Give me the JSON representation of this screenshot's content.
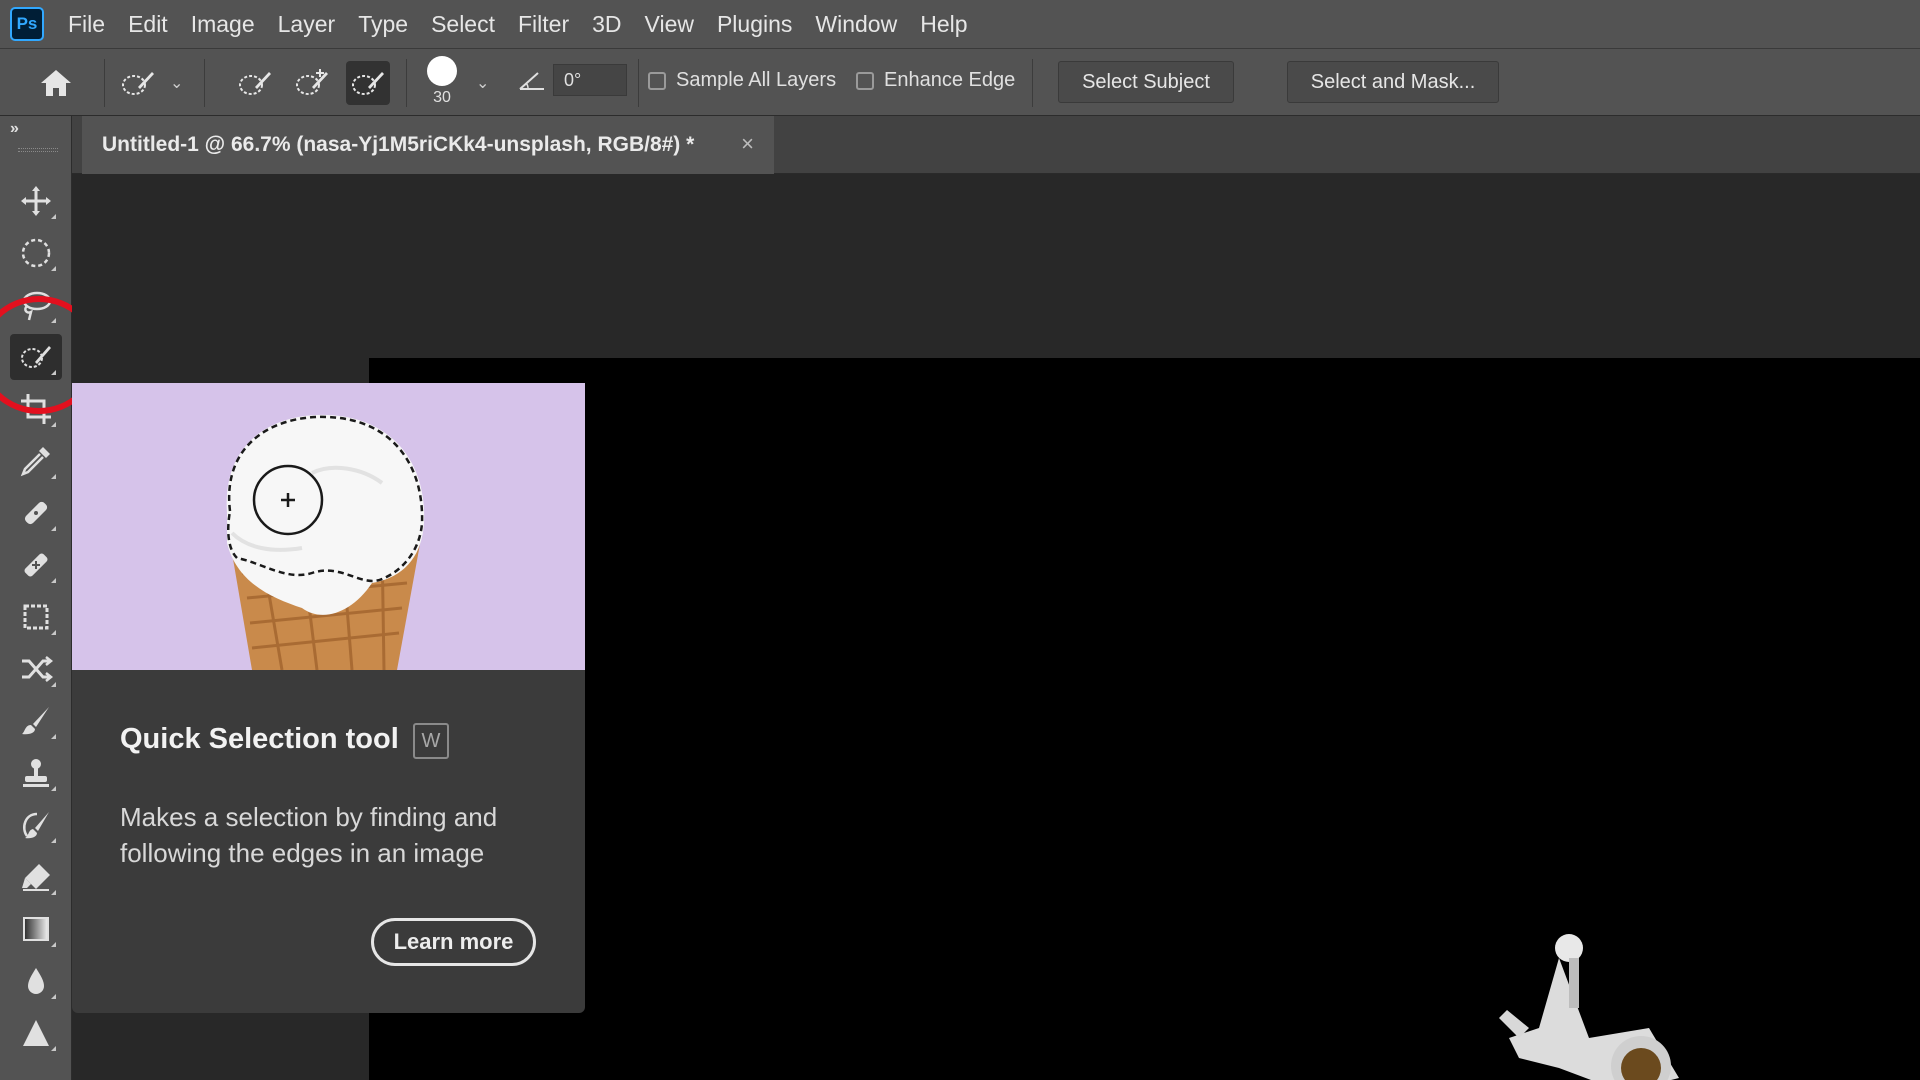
{
  "app": {
    "logo_text": "Ps"
  },
  "menu": [
    "File",
    "Edit",
    "Image",
    "Layer",
    "Type",
    "Select",
    "Filter",
    "3D",
    "View",
    "Plugins",
    "Window",
    "Help"
  ],
  "options": {
    "brush_size": "30",
    "angle": "0°",
    "sample_all_layers": "Sample All Layers",
    "enhance_edge": "Enhance Edge",
    "select_subject": "Select Subject",
    "select_and_mask": "Select and Mask..."
  },
  "toolbar": {
    "collapse": "»"
  },
  "document": {
    "tab_title": "Untitled-1 @ 66.7% (nasa-Yj1M5riCKk4-unsplash, RGB/8#) *",
    "close": "×"
  },
  "tooltip": {
    "title": "Quick Selection tool",
    "shortcut": "W",
    "description": "Makes a selection by finding and following the edges in an image",
    "learn_more": "Learn more"
  },
  "colors": {
    "highlight_ring": "#e3101e",
    "ps_brand": "#31a8ff",
    "tooltip_bg": "#d4c0e8"
  }
}
